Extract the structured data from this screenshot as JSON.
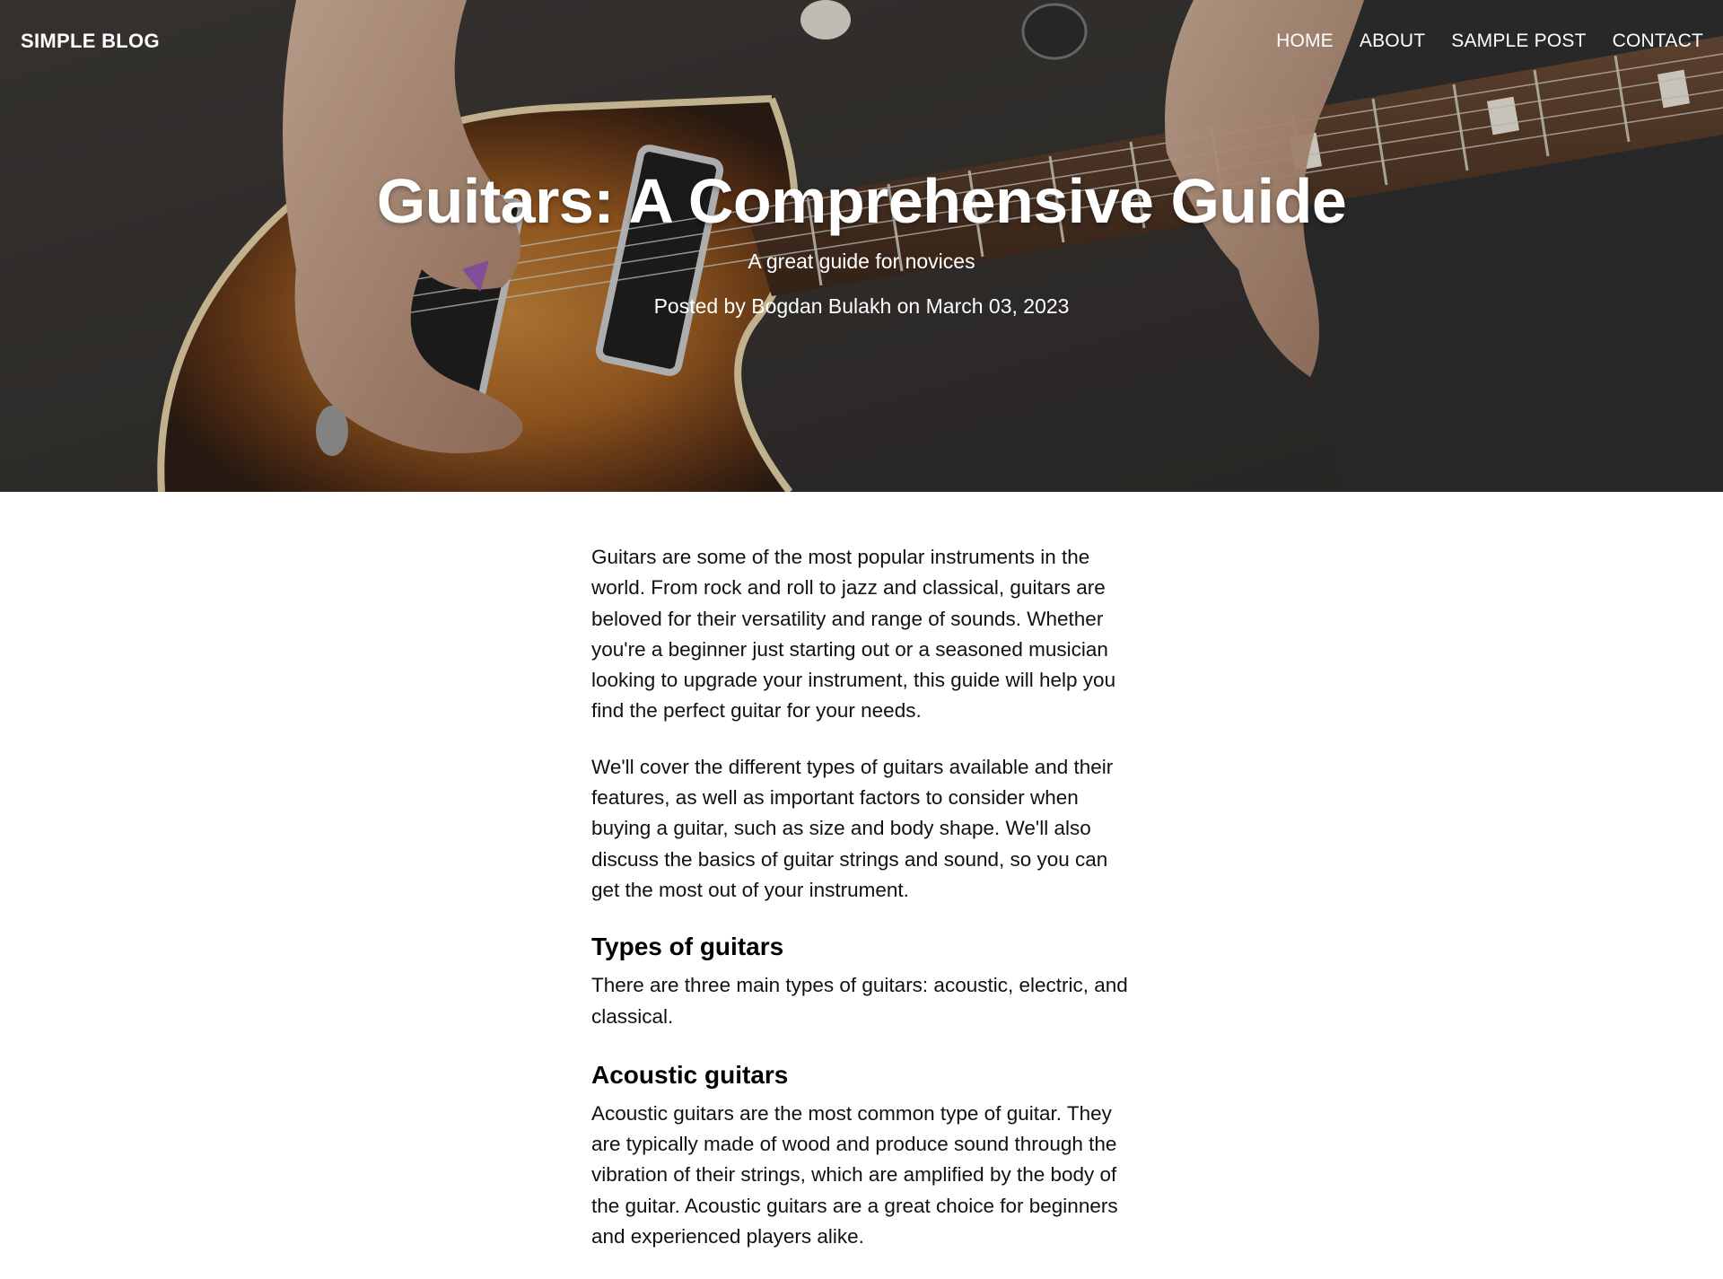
{
  "navbar": {
    "brand": "SIMPLE BLOG",
    "links": [
      "HOME",
      "ABOUT",
      "SAMPLE POST",
      "CONTACT"
    ]
  },
  "hero": {
    "title": "Guitars: A Comprehensive Guide",
    "subtitle": "A great guide for novices",
    "meta": "Posted by Bogdan Bulakh on March 03, 2023",
    "image": "electric guitar being played, sunburst body with pick"
  },
  "article": {
    "paragraphs": [
      "Guitars are some of the most popular instruments in the world. From rock and roll to jazz and classical, guitars are beloved for their versatility and range of sounds. Whether you're a beginner just starting out or a seasoned musician looking to upgrade your instrument, this guide will help you find the perfect guitar for your needs.",
      "We'll cover the different types of guitars available and their features, as well as important factors to consider when buying a guitar, such as size and body shape. We'll also discuss the basics of guitar strings and sound, so you can get the most out of your instrument."
    ],
    "sections": [
      {
        "heading": "Types of guitars",
        "body": "There are three main types of guitars: acoustic, electric, and classical."
      },
      {
        "heading": "Acoustic guitars",
        "body": "Acoustic guitars are the most common type of guitar. They are typically made of wood and produce sound through the vibration of their strings, which are amplified by the body of the guitar. Acoustic guitars are a great choice for beginners and experienced players alike."
      }
    ]
  }
}
